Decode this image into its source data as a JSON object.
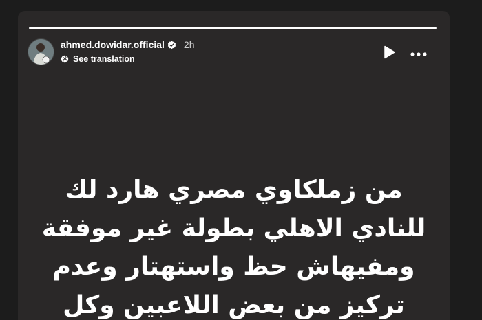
{
  "story": {
    "progress": 1.0,
    "username": "ahmed.dowidar.official",
    "verified": true,
    "time_ago": "2h",
    "translation_label": "See translation",
    "icons": {
      "avatar": "profile-avatar",
      "verified": "verified-badge-icon",
      "translation": "globe-icon",
      "play": "play-icon",
      "more": "more-options-icon"
    },
    "text_lines": [
      "من زملكاوي مصري هارد لك",
      "للنادي الاهلي بطولة غير موفقة",
      "ومفيهاش حظ واستهتار وعدم",
      "تركيز من بعض اللاعبين وكل"
    ]
  },
  "colors": {
    "page_background": "#1c1c1c",
    "story_background": "#2a2828",
    "text": "#ffffff"
  }
}
